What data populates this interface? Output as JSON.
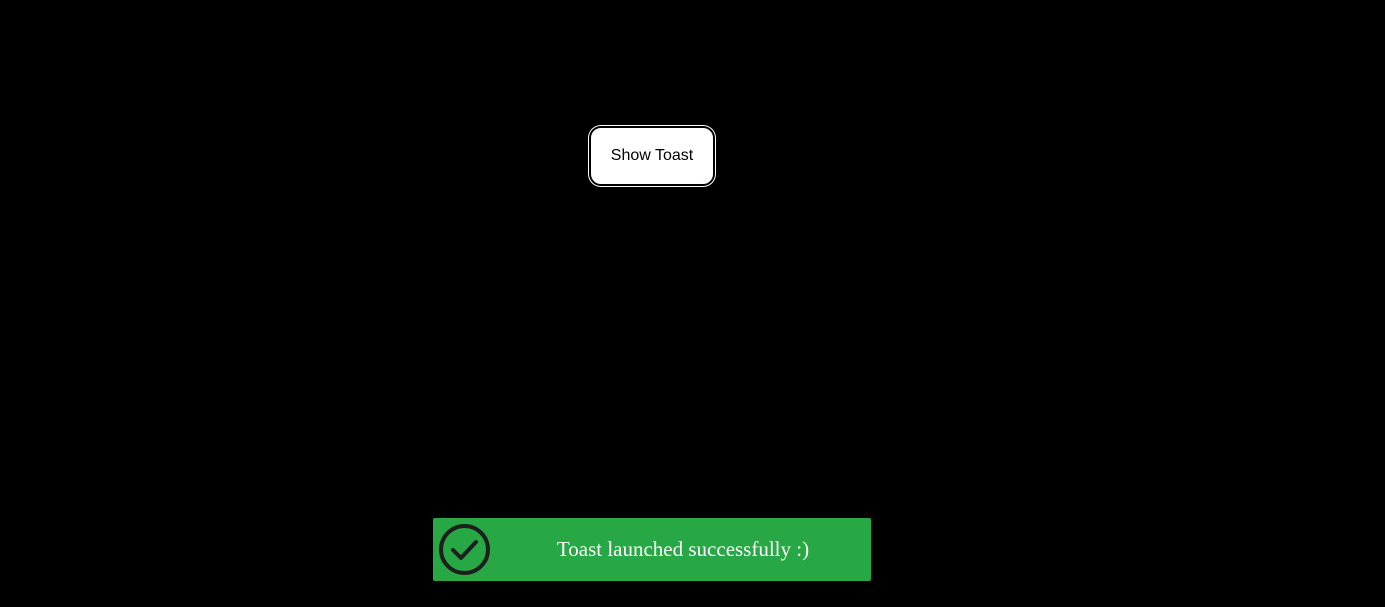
{
  "show_toast_button": {
    "label": "Show Toast"
  },
  "toast": {
    "message": "Toast launched successfully :)",
    "icon": "check-circle-icon",
    "background_color": "#28a745",
    "text_color": "#ffffff",
    "icon_color": "#1e1e1e"
  },
  "page": {
    "background_color": "#000000"
  }
}
